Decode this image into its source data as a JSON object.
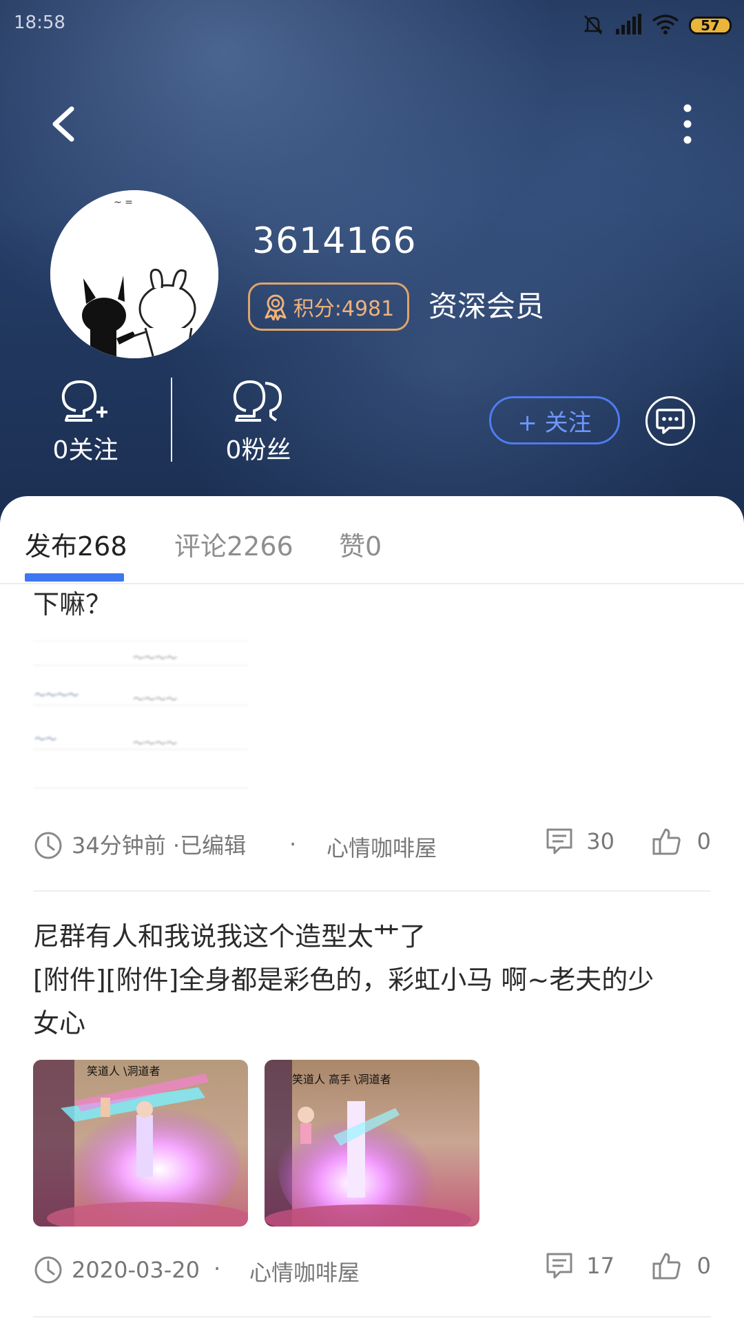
{
  "status_bar": {
    "time": "18:58",
    "battery": "57",
    "icons": [
      "mute-bell-icon",
      "signal-icon",
      "wifi-icon",
      "battery-icon"
    ]
  },
  "profile": {
    "username": "3614166",
    "points_label": "积分:4981",
    "member_level": "资深会员",
    "following_label": "0关注",
    "followers_label": "0粉丝",
    "follow_button": "+ 关注"
  },
  "tabs": [
    {
      "label": "发布268",
      "active": true
    },
    {
      "label": "评论2266",
      "active": false
    },
    {
      "label": "赞0",
      "active": false
    }
  ],
  "posts": [
    {
      "text_partial": "下嘛？",
      "time": "34分钟前 ·已编辑",
      "separator": "·",
      "forum": "心情咖啡屋",
      "comments": "30",
      "likes": "0"
    },
    {
      "title": "尼群有人和我说我这个造型太艹了",
      "body_line1": "[附件][附件]全身都是彩色的，彩虹小马 啊~老夫的少",
      "body_line2": "女心",
      "image1_caption": "笑道人 \\洞道者",
      "image2_caption": "笑道人 高手 \\洞道者",
      "time": "2020-03-20",
      "separator": "·",
      "forum": "心情咖啡屋",
      "comments": "17",
      "likes": "0"
    }
  ],
  "colors": {
    "accent": "#3e77f1",
    "points_border": "#e0a56a",
    "header_bg": "#233a62"
  }
}
